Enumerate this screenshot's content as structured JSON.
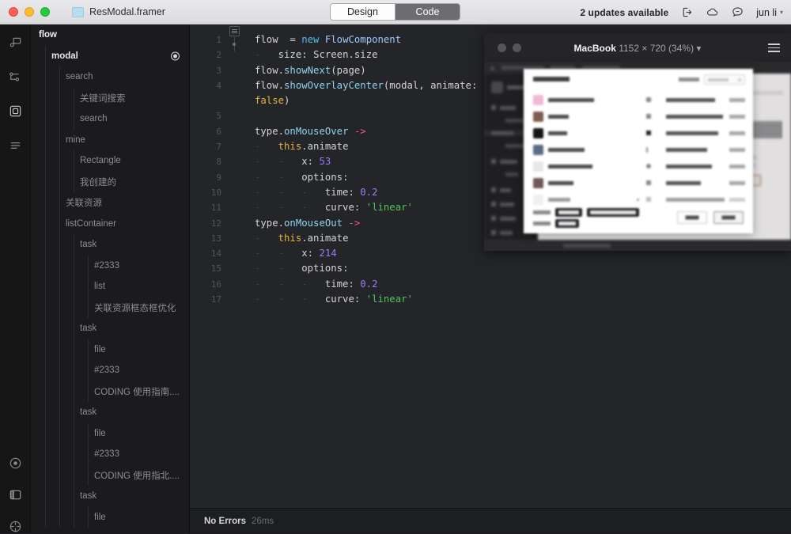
{
  "titlebar": {
    "document_title": "ResModal.framer",
    "tabs": [
      {
        "label": "Design",
        "active": false
      },
      {
        "label": "Code",
        "active": true
      }
    ],
    "updates_text": "2 updates available",
    "icons": [
      "export-icon",
      "cloud-icon",
      "comment-icon"
    ],
    "user_name": "jun li",
    "chevron": "▾"
  },
  "rail": {
    "items": [
      {
        "name": "components-icon"
      },
      {
        "name": "connections-icon"
      },
      {
        "name": "frame-icon"
      },
      {
        "name": "list-icon"
      }
    ],
    "bottom_items": [
      {
        "name": "record-icon"
      },
      {
        "name": "panel-icon"
      },
      {
        "name": "target-icon"
      }
    ]
  },
  "layers": {
    "items": [
      {
        "label": "flow",
        "depth": 0,
        "selected": false
      },
      {
        "label": "modal",
        "depth": 1,
        "selected": true
      },
      {
        "label": "search",
        "depth": 2,
        "selected": false
      },
      {
        "label": "关键词搜索",
        "depth": 3,
        "selected": false
      },
      {
        "label": "search",
        "depth": 3,
        "selected": false
      },
      {
        "label": "mine",
        "depth": 2,
        "selected": false
      },
      {
        "label": "Rectangle",
        "depth": 3,
        "selected": false
      },
      {
        "label": "我创建的",
        "depth": 3,
        "selected": false
      },
      {
        "label": "关联资源",
        "depth": 2,
        "selected": false
      },
      {
        "label": "listContainer",
        "depth": 2,
        "selected": false
      },
      {
        "label": "task",
        "depth": 3,
        "selected": false
      },
      {
        "label": "#2333",
        "depth": 4,
        "selected": false
      },
      {
        "label": "list",
        "depth": 4,
        "selected": false
      },
      {
        "label": "关联资源框态框优化",
        "depth": 4,
        "selected": false
      },
      {
        "label": "task",
        "depth": 3,
        "selected": false
      },
      {
        "label": "file",
        "depth": 4,
        "selected": false
      },
      {
        "label": "#2333",
        "depth": 4,
        "selected": false
      },
      {
        "label": "CODING 使用指南....",
        "depth": 4,
        "selected": false
      },
      {
        "label": "task",
        "depth": 3,
        "selected": false
      },
      {
        "label": "file",
        "depth": 4,
        "selected": false
      },
      {
        "label": "#2333",
        "depth": 4,
        "selected": false
      },
      {
        "label": "CODING 使用指北....",
        "depth": 4,
        "selected": false
      },
      {
        "label": "task",
        "depth": 3,
        "selected": false
      },
      {
        "label": "file",
        "depth": 4,
        "selected": false
      }
    ]
  },
  "editor": {
    "line_numbers": [
      "1",
      "2",
      "3",
      "4",
      "",
      "5",
      "6",
      "7",
      "8",
      "9",
      "10",
      "11",
      "12",
      "13",
      "14",
      "15",
      "16",
      "17"
    ],
    "lines": [
      {
        "no": "1",
        "tokens": [
          {
            "t": "flow",
            "c": "pl"
          },
          {
            "t": "  = ",
            "c": "pl"
          },
          {
            "t": "new",
            "c": "kw"
          },
          {
            "t": " ",
            "c": "pl"
          },
          {
            "t": "FlowComponent",
            "c": "cls"
          }
        ]
      },
      {
        "no": "2",
        "tokens": [
          {
            "t": "-   ",
            "c": "ind"
          },
          {
            "t": "size",
            "c": "prop"
          },
          {
            "t": ": ",
            "c": "pl"
          },
          {
            "t": "Screen",
            "c": "pl"
          },
          {
            "t": ".",
            "c": "pl"
          },
          {
            "t": "size",
            "c": "pl"
          }
        ]
      },
      {
        "no": "3",
        "tokens": [
          {
            "t": "flow",
            "c": "pl"
          },
          {
            "t": ".",
            "c": "pl"
          },
          {
            "t": "showNext",
            "c": "fn"
          },
          {
            "t": "(page)",
            "c": "pl"
          }
        ]
      },
      {
        "no": "4",
        "tokens": [
          {
            "t": "flow",
            "c": "pl"
          },
          {
            "t": ".",
            "c": "pl"
          },
          {
            "t": "showOverlayCenter",
            "c": "fn"
          },
          {
            "t": "(modal, animate:",
            "c": "pl"
          }
        ]
      },
      {
        "no": "",
        "tokens": [
          {
            "t": "false",
            "c": "bool"
          },
          {
            "t": ")",
            "c": "pl"
          }
        ]
      },
      {
        "no": "5",
        "tokens": []
      },
      {
        "no": "6",
        "tokens": [
          {
            "t": "type",
            "c": "pl"
          },
          {
            "t": ".",
            "c": "pl"
          },
          {
            "t": "onMouseOver",
            "c": "fn"
          },
          {
            "t": " ",
            "c": "pl"
          },
          {
            "t": "->",
            "c": "arw"
          }
        ]
      },
      {
        "no": "7",
        "tokens": [
          {
            "t": "-   ",
            "c": "ind"
          },
          {
            "t": "this",
            "c": "this"
          },
          {
            "t": ".",
            "c": "pl"
          },
          {
            "t": "animate",
            "c": "pl"
          }
        ]
      },
      {
        "no": "8",
        "tokens": [
          {
            "t": "-   -   ",
            "c": "ind"
          },
          {
            "t": "x",
            "c": "pl"
          },
          {
            "t": ": ",
            "c": "pl"
          },
          {
            "t": "53",
            "c": "num"
          }
        ]
      },
      {
        "no": "9",
        "tokens": [
          {
            "t": "-   -   ",
            "c": "ind"
          },
          {
            "t": "options",
            "c": "pl"
          },
          {
            "t": ":",
            "c": "pl"
          }
        ]
      },
      {
        "no": "10",
        "tokens": [
          {
            "t": "-   -   -   ",
            "c": "ind"
          },
          {
            "t": "time",
            "c": "pl"
          },
          {
            "t": ": ",
            "c": "pl"
          },
          {
            "t": "0.2",
            "c": "num"
          }
        ]
      },
      {
        "no": "11",
        "tokens": [
          {
            "t": "-   -   -   ",
            "c": "ind"
          },
          {
            "t": "curve",
            "c": "pl"
          },
          {
            "t": ": ",
            "c": "pl"
          },
          {
            "t": "'linear'",
            "c": "str"
          }
        ]
      },
      {
        "no": "12",
        "tokens": [
          {
            "t": "type",
            "c": "pl"
          },
          {
            "t": ".",
            "c": "pl"
          },
          {
            "t": "onMouseOut",
            "c": "fn"
          },
          {
            "t": " ",
            "c": "pl"
          },
          {
            "t": "->",
            "c": "arw"
          }
        ]
      },
      {
        "no": "13",
        "tokens": [
          {
            "t": "-   ",
            "c": "ind"
          },
          {
            "t": "this",
            "c": "this"
          },
          {
            "t": ".",
            "c": "pl"
          },
          {
            "t": "animate",
            "c": "pl"
          }
        ]
      },
      {
        "no": "14",
        "tokens": [
          {
            "t": "-   -   ",
            "c": "ind"
          },
          {
            "t": "x",
            "c": "pl"
          },
          {
            "t": ": ",
            "c": "pl"
          },
          {
            "t": "214",
            "c": "num"
          }
        ]
      },
      {
        "no": "15",
        "tokens": [
          {
            "t": "-   -   ",
            "c": "ind"
          },
          {
            "t": "options",
            "c": "pl"
          },
          {
            "t": ":",
            "c": "pl"
          }
        ]
      },
      {
        "no": "16",
        "tokens": [
          {
            "t": "-   -   -   ",
            "c": "ind"
          },
          {
            "t": "time",
            "c": "pl"
          },
          {
            "t": ": ",
            "c": "pl"
          },
          {
            "t": "0.2",
            "c": "num"
          }
        ]
      },
      {
        "no": "17",
        "tokens": [
          {
            "t": "-   -   -   ",
            "c": "ind"
          },
          {
            "t": "curve",
            "c": "pl"
          },
          {
            "t": ": ",
            "c": "pl"
          },
          {
            "t": "'linear'",
            "c": "str"
          }
        ]
      }
    ]
  },
  "status": {
    "message": "No Errors",
    "timing": "26ms"
  },
  "preview": {
    "device": "MacBook",
    "resolution": "1152 × 720 (34%)",
    "chevron": "▾",
    "menu_icon": "hamburger-icon"
  },
  "colors": {
    "accent_blue": "#4fc1e9",
    "string_green": "#52c45a",
    "number_purple": "#9a7df0",
    "bool_yellow": "#e3b341",
    "arrow_pink": "#ef5a78",
    "titlebar_bg": "#e4e3e5",
    "editor_bg": "#242528",
    "tree_bg": "#1b1b1d"
  }
}
